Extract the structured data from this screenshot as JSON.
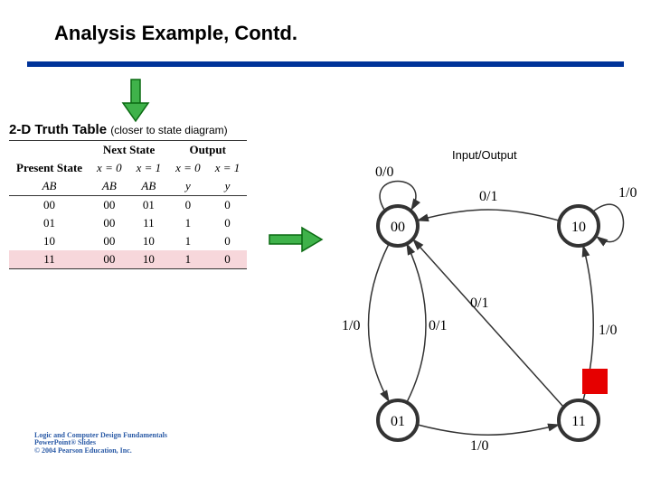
{
  "title": "Analysis Example, Contd.",
  "subtitle": "2-D Truth Table",
  "subtitle_note": "(closer to state diagram)",
  "io_label": "Input/Output",
  "table": {
    "group_headers": [
      "Present State",
      "Next State",
      "Output"
    ],
    "sub_headers": [
      "AB",
      "x = 0",
      "x = 1",
      "x = 0",
      "x = 1"
    ],
    "sub_line2": [
      "",
      "AB",
      "AB",
      "y",
      "y"
    ],
    "rows": [
      [
        "00",
        "00",
        "01",
        "0",
        "0"
      ],
      [
        "01",
        "00",
        "11",
        "1",
        "0"
      ],
      [
        "10",
        "00",
        "10",
        "1",
        "0"
      ],
      [
        "11",
        "00",
        "10",
        "1",
        "0"
      ]
    ]
  },
  "states": {
    "s00": "00",
    "s01": "01",
    "s10": "10",
    "s11": "11"
  },
  "edges": {
    "s00_loop": "0/0",
    "s10_loop": "1/0",
    "s10_to_00": "0/1",
    "s00_to_01": "1/0",
    "s01_to_00": "0/1",
    "s01_to_11": "1/0",
    "s11_to_00": "0/1",
    "s11_to_10": "1/0"
  },
  "copyright": {
    "l1": "Logic and Computer Design Fundamentals",
    "l2": "PowerPoint® Slides",
    "l3": "© 2004 Pearson Education, Inc."
  }
}
